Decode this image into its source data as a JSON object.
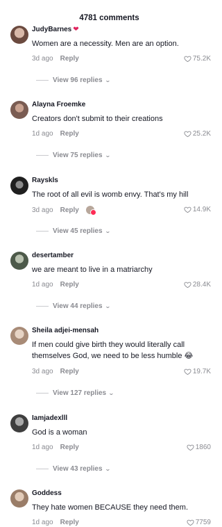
{
  "header": {
    "title": "4781 comments"
  },
  "icons": {
    "like": "heart-outline-icon",
    "expand": "chevron-down-icon",
    "badge": "heart-badge-icon"
  },
  "colors": {
    "text": "#161823",
    "muted": "#8a8b91",
    "badge": "#e0245e"
  },
  "comments": [
    {
      "username": "JudyBarnes",
      "badge": "❤",
      "text": "Women are a necessity. Men are an option.",
      "age": "3d ago",
      "reply": "Reply",
      "likes": "75.2K",
      "view_replies": "View 96 replies"
    },
    {
      "username": "Alayna Froemke",
      "text": "Creators don't submit to their creations",
      "age": "1d ago",
      "reply": "Reply",
      "likes": "25.2K",
      "view_replies": "View 75 replies"
    },
    {
      "username": "Rayskls",
      "text": "The root of all evil is womb envy. That's my hill",
      "age": "3d ago",
      "reply": "Reply",
      "likes": "14.9K",
      "view_replies": "View 45 replies"
    },
    {
      "username": "desertamber",
      "text": "we are meant to live in a matriarchy",
      "age": "1d ago",
      "reply": "Reply",
      "likes": "28.4K",
      "view_replies": "View 44 replies"
    },
    {
      "username": "Sheila adjei-mensah",
      "text": "If men could give birth they would literally call themselves God, we need to be less humble 😂",
      "age": "3d ago",
      "reply": "Reply",
      "likes": "19.7K",
      "view_replies": "View 127 replies"
    },
    {
      "username": "Iamjadexlll",
      "text": "God is a woman",
      "age": "1d ago",
      "reply": "Reply",
      "likes": "1860",
      "view_replies": "View 43 replies"
    },
    {
      "username": "Goddess",
      "text": "They hate women BECAUSE they need them.",
      "age": "1d ago",
      "reply": "Reply",
      "likes": "7759"
    }
  ]
}
